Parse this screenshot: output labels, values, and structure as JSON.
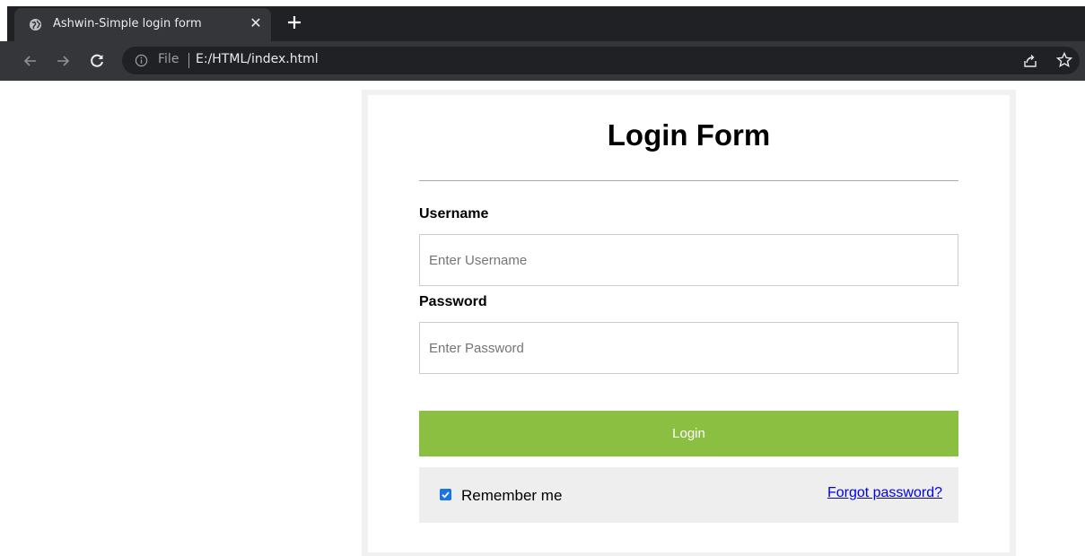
{
  "browser": {
    "tab_title": "Ashwin-Simple login form",
    "close_glyph": "✕",
    "scheme_label": "File",
    "url": "E:/HTML/index.html"
  },
  "form": {
    "title": "Login Form",
    "username_label": "Username",
    "username_placeholder": "Enter Username",
    "password_label": "Password",
    "password_placeholder": "Enter Password",
    "login_button": "Login",
    "remember_label": "Remember me",
    "remember_checked": true,
    "forgot_link": "Forgot password?"
  },
  "colors": {
    "login_button": "#8bbf42",
    "link": "#0000ee",
    "chrome_dark": "#202124",
    "chrome_tab": "#35363a"
  }
}
